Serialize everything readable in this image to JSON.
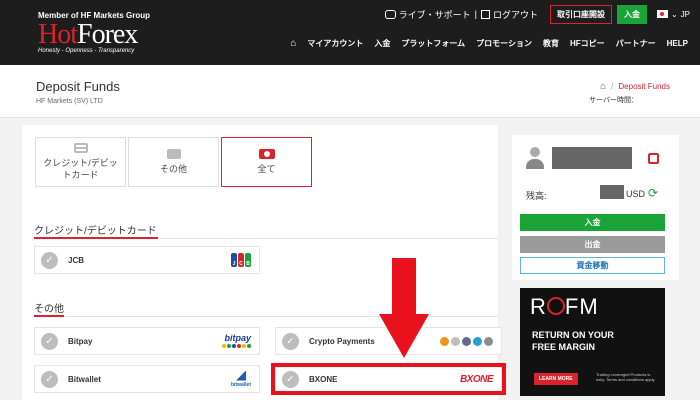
{
  "header": {
    "member_text": "Member of HF Markets Group",
    "logo_hot": "Hot",
    "logo_forex": "Forex",
    "tagline": "Honesty - Openness - Transparency",
    "live_support": "ライブ・サポート",
    "logout": "ログアウト",
    "separator": "|",
    "open_account": "取引口座開設",
    "deposit": "入金",
    "language": "JP",
    "nav": [
      "マイアカウント",
      "入金",
      "プラットフォーム",
      "プロモーション",
      "教育",
      "HFコピー",
      "パートナー",
      "HELP"
    ]
  },
  "titlebar": {
    "title": "Deposit Funds",
    "company": "HF Markets (SV) LTD",
    "breadcrumb_sep": "/",
    "breadcrumb_current": "Deposit Funds",
    "server_time_label": "サーバー時間："
  },
  "tabs": [
    {
      "label": "クレジット/デビットカード",
      "icon": "credit-card-icon"
    },
    {
      "label": "その他",
      "icon": "wallet-icon"
    },
    {
      "label": "全て",
      "icon": "money-icon"
    }
  ],
  "sections": {
    "cards": "クレジット/デビットカード",
    "other": "その他"
  },
  "methods": {
    "jcb": {
      "name": "JCB",
      "logo": "JCB"
    },
    "bitpay": {
      "name": "Bitpay",
      "logo": "bitpay"
    },
    "crypto": {
      "name": "Crypto Payments"
    },
    "bitwallet": {
      "name": "Bitwallet",
      "logo": "bitwallet"
    },
    "bxone": {
      "name": "BXONE",
      "logo": "BXONE"
    }
  },
  "sidebar": {
    "balance_label": "残高:",
    "currency": "USD",
    "deposit_button": "入金",
    "withdraw_button": "出金",
    "transfer_button": "資金移動"
  },
  "ad": {
    "title_r": "R",
    "title_fm": "FM",
    "line1": "RETURN ON YOUR",
    "line2": "FREE MARGIN",
    "button": "LEARN MORE",
    "disclaimer": "Trading Leveraged Products is risky. Terms and conditions apply."
  },
  "colors": {
    "brand_red": "#d9232d",
    "brand_green": "#1aa336",
    "header_bg": "#1d1d1d",
    "annotation_red": "#e8111c"
  }
}
